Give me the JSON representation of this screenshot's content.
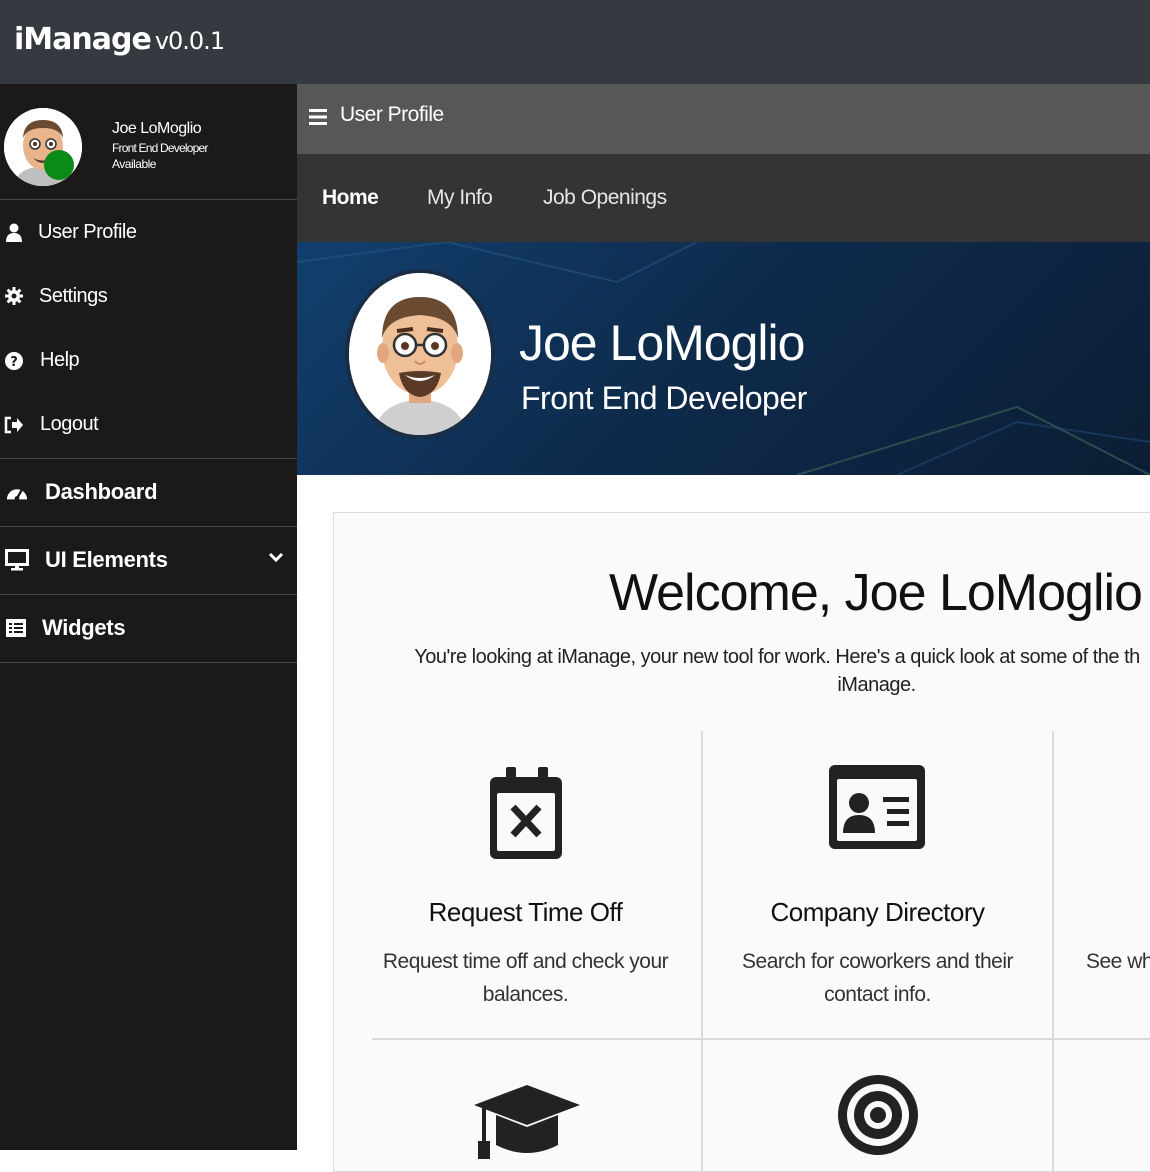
{
  "app": {
    "name": "iManage",
    "version": "v0.0.1"
  },
  "user": {
    "name": "Joe LoMoglio",
    "role": "Front End Developer",
    "status": "Available",
    "status_color": "#0b8a17"
  },
  "sidebar": {
    "account_items": [
      {
        "label": "User Profile",
        "icon": "user-icon"
      },
      {
        "label": "Settings",
        "icon": "gear-icon"
      },
      {
        "label": "Help",
        "icon": "question-icon"
      },
      {
        "label": "Logout",
        "icon": "sign-out-icon"
      }
    ],
    "nav_items": [
      {
        "label": "Dashboard",
        "icon": "dashboard-icon"
      },
      {
        "label": "UI Elements",
        "icon": "monitor-icon",
        "has_submenu": true
      },
      {
        "label": "Widgets",
        "icon": "list-icon"
      }
    ]
  },
  "page": {
    "title": "User Profile"
  },
  "tabs": [
    {
      "label": "Home",
      "active": true
    },
    {
      "label": "My Info",
      "active": false
    },
    {
      "label": "Job Openings",
      "active": false
    }
  ],
  "hero": {
    "name": "Joe LoMoglio",
    "role": "Front End Developer"
  },
  "welcome": {
    "title": "Welcome, Joe LoMoglio",
    "intro_line1": "You're looking at iManage, your new tool for work. Here's a quick look at some of the th",
    "intro_line2": "iManage."
  },
  "cards": [
    {
      "title": "Request Time Off",
      "desc_line1": "Request time off and check your",
      "desc_line2": "balances.",
      "icon": "calendar-x-icon"
    },
    {
      "title": "Company Directory",
      "desc_line1": "Search for coworkers and their",
      "desc_line2": "contact info.",
      "icon": "id-card-icon"
    },
    {
      "title": "",
      "desc_line1": "See whi",
      "desc_line2": "",
      "icon": ""
    },
    {
      "icon": "graduation-cap-icon"
    },
    {
      "icon": "target-icon"
    }
  ],
  "colors": {
    "topbar": "#343a40",
    "sidebar": "#1b1a19",
    "pagebar": "#575757",
    "tabbar": "#343434",
    "hero": "#0e2b4c"
  }
}
